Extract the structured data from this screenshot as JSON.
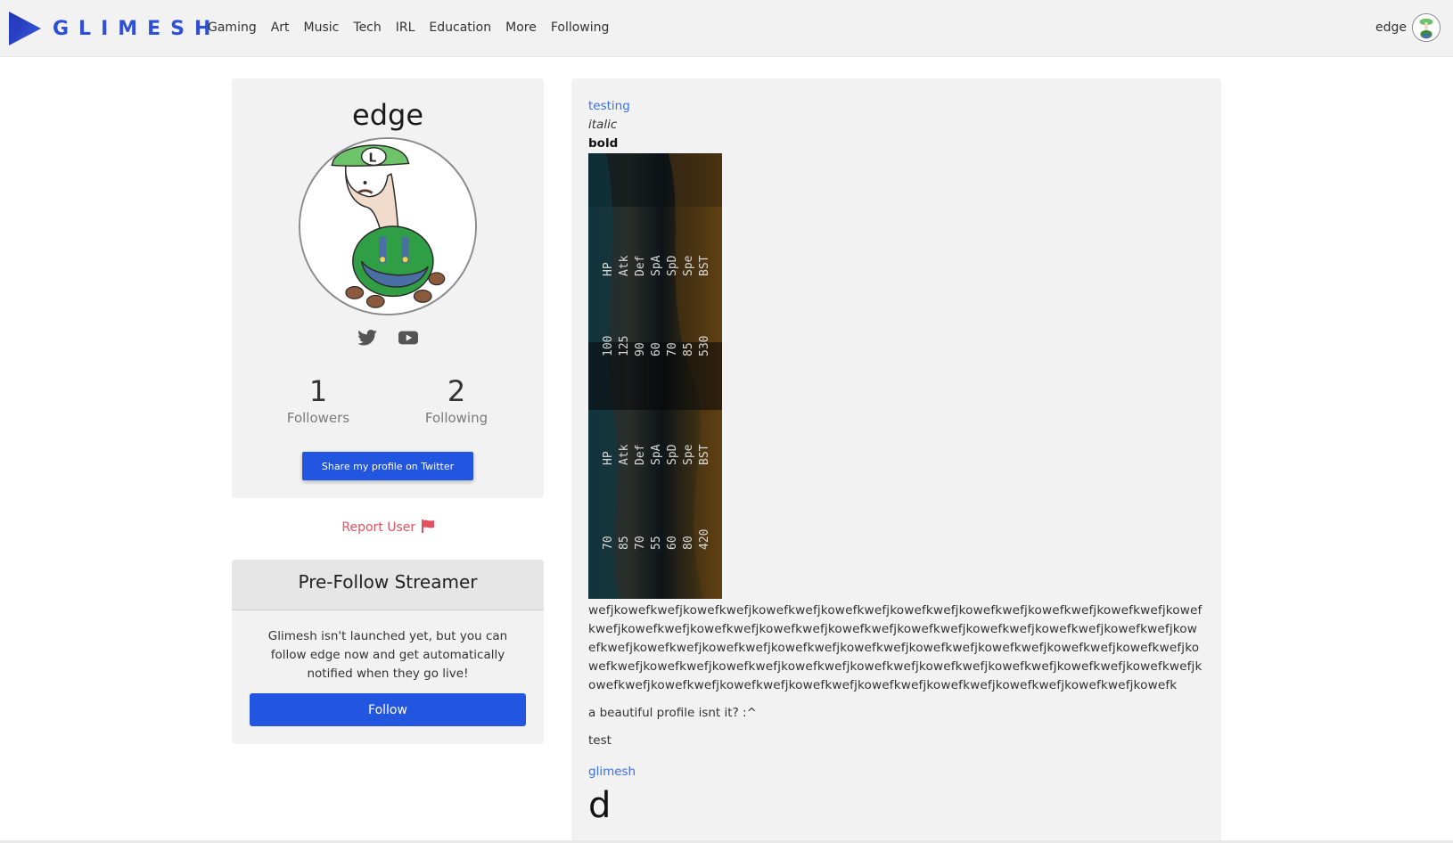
{
  "navbar": {
    "brand": "GLIMESH",
    "links": [
      "Gaming",
      "Art",
      "Music",
      "Tech",
      "IRL",
      "Education",
      "More",
      "Following"
    ],
    "user_name": "edge"
  },
  "profile": {
    "username": "edge",
    "social_icons": [
      "twitter-icon",
      "youtube-icon"
    ],
    "followers_count": "1",
    "followers_label": "Followers",
    "following_count": "2",
    "following_label": "Following",
    "share_button": "Share my profile on Twitter"
  },
  "report": {
    "label": "Report User",
    "icon": "flag-icon"
  },
  "prefollow": {
    "title": "Pre-Follow Streamer",
    "text": "Glimesh isn't launched yet, but you can follow edge now and get automatically notified when they go live!",
    "button": "Follow"
  },
  "bio": {
    "link1": "testing",
    "italic": "italic",
    "bold": "bold",
    "image_rows": [
      [
        "HP",
        "Atk",
        "Def",
        "SpA",
        "SpD",
        "Spe",
        "BST"
      ],
      [
        "100",
        "125",
        "90",
        "60",
        "70",
        "85",
        "530"
      ],
      [
        "HP",
        "Atk",
        "Def",
        "SpA",
        "SpD",
        "Spe",
        "BST"
      ],
      [
        "70",
        "85",
        "70",
        "55",
        "60",
        "80",
        "420"
      ]
    ],
    "long_text": "wefjkowefkwefjkowefkwefjkowefkwefjkowefkwefjkowefkwefjkowefkwefjkowefkwefjkowefkwefjkowefkwefjkowefkwefjkowefkwefjkowefkwefjkowefkwefjkowefkwefjkowefkwefjkowefkwefjkowefkwefjkowefkwefjkowefkwefjkowefkwefjkowefkwefjkowefkwefjkowefkwefjkowefkwefjkowefkwefjkowefkwefjkowefkwefjkowefkwefjkowefkwefjkowefkwefjkowefkwefjkowefkwefjkowefkwefjkowefkwefjkowefkwefjkowefkwefjkowefkwefjkowefkwefjkowefkwefjkowefkwefjkowefkwefjkowefkwefjkowefkwefjkowefk",
    "para1": "a beautiful profile isnt it? :^",
    "para2": "test",
    "link2": "glimesh",
    "big_text": "d"
  },
  "colors": {
    "brand": "#2e50d6",
    "primary_button": "#2255e0",
    "link": "#3b6fe0",
    "danger": "#e05260",
    "card_bg": "#f2f2f2"
  }
}
